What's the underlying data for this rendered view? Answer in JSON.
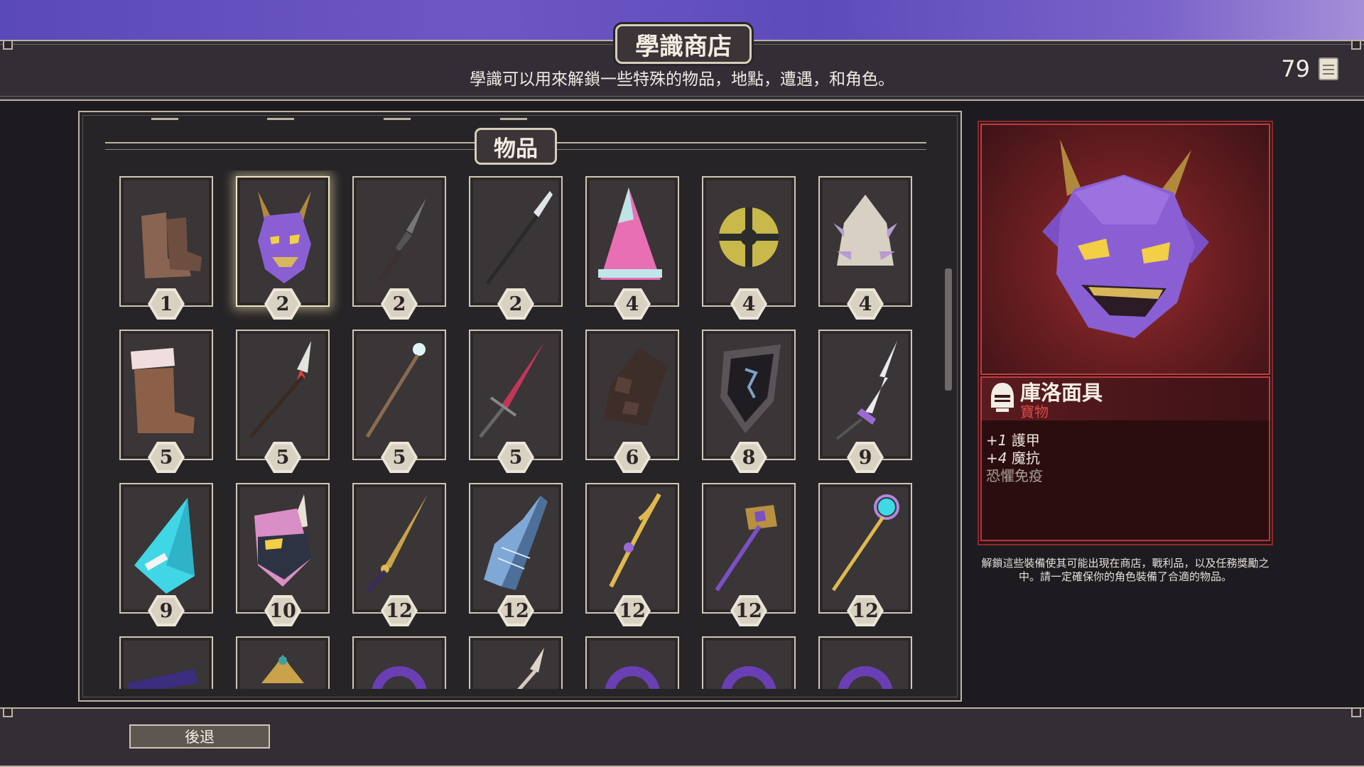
{
  "header": {
    "title": "學識商店",
    "subtitle": "學識可以用來解鎖一些特殊的物品，地點，遭遇，和角色。",
    "currency_value": "79",
    "currency_icon": "scroll-icon"
  },
  "catalog": {
    "section_title": "物品",
    "items": [
      {
        "name": "boots",
        "cost": "1"
      },
      {
        "name": "oni-mask",
        "cost": "2",
        "selected": true
      },
      {
        "name": "wavy-dagger",
        "cost": "2"
      },
      {
        "name": "glaive",
        "cost": "2"
      },
      {
        "name": "pink-wizard-hat",
        "cost": "4"
      },
      {
        "name": "round-shield",
        "cost": "4"
      },
      {
        "name": "spiked-helmet",
        "cost": "4"
      },
      {
        "name": "fur-boots",
        "cost": "5"
      },
      {
        "name": "flame-spear",
        "cost": "5"
      },
      {
        "name": "ice-staff",
        "cost": "5"
      },
      {
        "name": "crimson-sword",
        "cost": "5"
      },
      {
        "name": "gauntlet",
        "cost": "6"
      },
      {
        "name": "dark-shield",
        "cost": "8"
      },
      {
        "name": "lightning-sword",
        "cost": "9"
      },
      {
        "name": "crystal-hat",
        "cost": "9"
      },
      {
        "name": "boar-helm",
        "cost": "10"
      },
      {
        "name": "golden-sword",
        "cost": "12"
      },
      {
        "name": "harp",
        "cost": "12"
      },
      {
        "name": "golden-bow",
        "cost": "12"
      },
      {
        "name": "war-hammer",
        "cost": "12"
      },
      {
        "name": "orb-staff",
        "cost": "12"
      },
      {
        "name": "spellbook",
        "cost": ""
      },
      {
        "name": "golden-crown",
        "cost": ""
      },
      {
        "name": "purple-ring",
        "cost": ""
      },
      {
        "name": "bone-spear",
        "cost": ""
      },
      {
        "name": "purple-ring",
        "cost": ""
      },
      {
        "name": "purple-ring",
        "cost": ""
      },
      {
        "name": "purple-ring",
        "cost": ""
      }
    ]
  },
  "detail": {
    "name": "庫洛面具",
    "type": "寶物",
    "stats": [
      {
        "num": "+1",
        "label": "護甲"
      },
      {
        "num": "+4",
        "label": "魔抗"
      }
    ],
    "extra": "恐懼免疫",
    "note": "解鎖這些裝備使其可能出現在商店，戰利品，以及任務獎勵之中。請一定確保你的角色裝備了合適的物品。",
    "type_color": "#e04848"
  },
  "footer": {
    "back_label": "後退"
  }
}
